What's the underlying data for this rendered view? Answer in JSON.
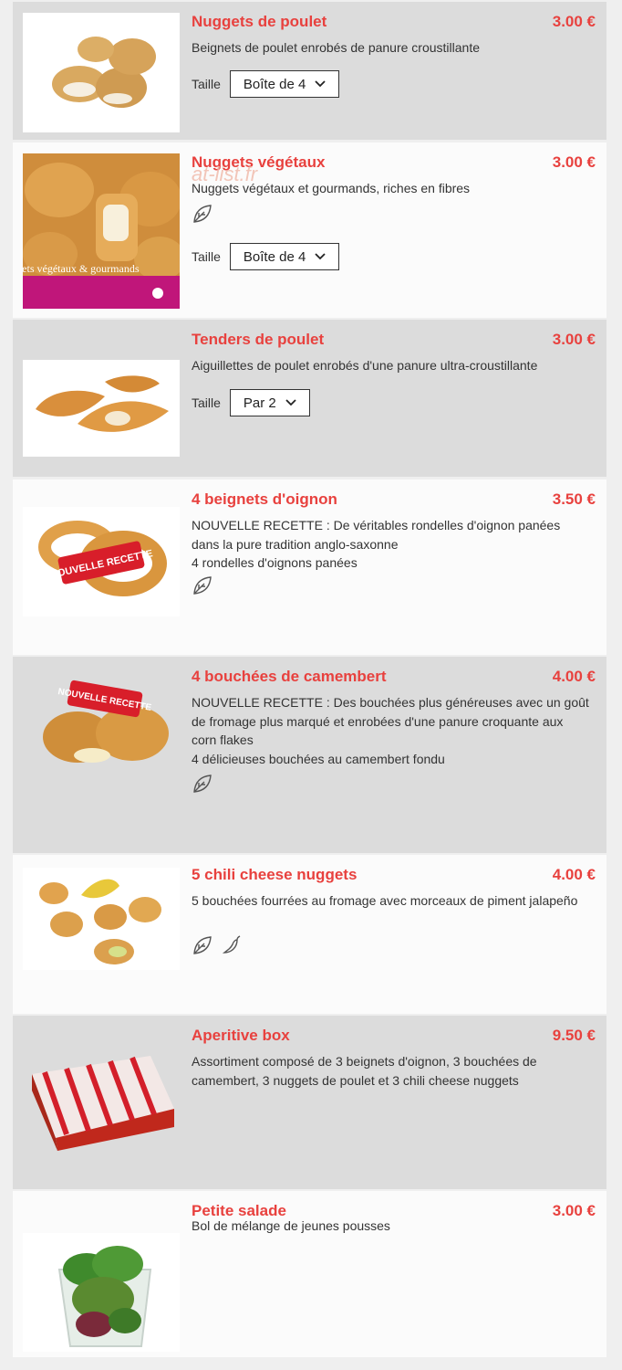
{
  "items": [
    {
      "title": "Nuggets de poulet",
      "price": "3.00 €",
      "desc": [
        "Beignets de poulet enrobés de panure croustillante"
      ],
      "size_label": "Taille",
      "size_value": "Boîte de 4"
    },
    {
      "title": "Nuggets végétaux",
      "price": "3.00 €",
      "desc": [
        "Nuggets végétaux et gourmands, riches en fibres"
      ],
      "size_label": "Taille",
      "size_value": "Boîte de 4",
      "icons": [
        "leaf-icon"
      ],
      "image_text": "Nuggets végétaux & gourmands"
    },
    {
      "title": "Tenders de poulet",
      "price": "3.00 €",
      "desc": [
        "Aiguillettes de poulet enrobés d'une panure ultra-croustillante"
      ],
      "size_label": "Taille",
      "size_value": "Par 2"
    },
    {
      "title": "4 beignets d'oignon",
      "price": "3.50 €",
      "desc": [
        "NOUVELLE RECETTE : De véritables rondelles d'oignon panées dans la pure tradition anglo-saxonne",
        "4 rondelles d'oignons panées"
      ],
      "icons": [
        "leaf-icon"
      ],
      "image_text": "NOUVELLE RECETTE"
    },
    {
      "title": "4 bouchées de camembert",
      "price": "4.00 €",
      "desc": [
        "NOUVELLE RECETTE : Des bouchées plus généreuses avec un goût de fromage plus marqué et enrobées d'une panure croquante aux corn flakes",
        "4 délicieuses bouchées au camembert fondu"
      ],
      "icons": [
        "leaf-icon"
      ],
      "image_text": "NOUVELLE RECETTE"
    },
    {
      "title": "5 chili cheese nuggets",
      "price": "4.00 €",
      "desc": [
        "5 bouchées fourrées au fromage avec morceaux de piment jalapeño"
      ],
      "icons": [
        "leaf-icon",
        "chili-icon"
      ]
    },
    {
      "title": "Aperitive box",
      "price": "9.50 €",
      "desc": [
        "Assortiment composé de 3 beignets d'oignon, 3 bouchées de camembert, 3 nuggets de poulet et 3 chili cheese nuggets"
      ]
    },
    {
      "title": "Petite salade",
      "price": "3.00 €",
      "desc": [
        "Bol de mélange de jeunes pousses"
      ]
    }
  ],
  "watermark": "at-list.fr",
  "colors": {
    "accent": "#e8413e",
    "grey_row": "#dcdcdc",
    "white_row": "#fbfbfb",
    "text": "#333333"
  }
}
